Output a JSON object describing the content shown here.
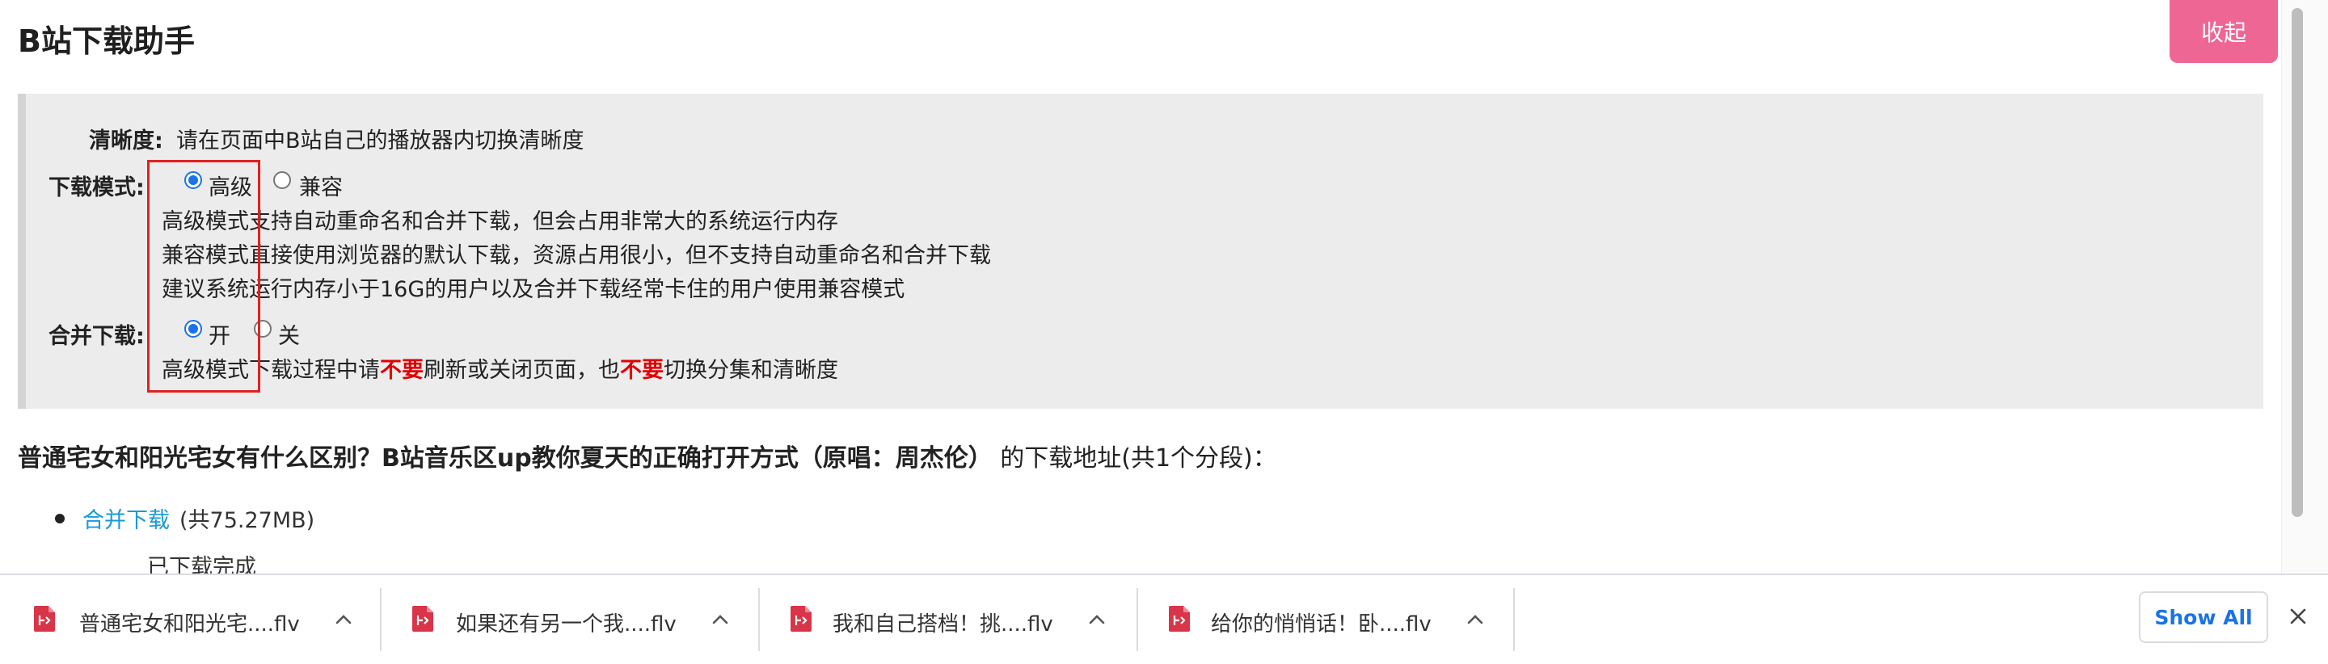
{
  "header": {
    "title": "B站下载助手",
    "collapse_label": "收起"
  },
  "settings": {
    "quality_label": "清晰度:",
    "quality_text": "请在页面中B站自己的播放器内切换清晰度",
    "mode_label": "下载模式:",
    "mode_options": [
      "高级",
      "兼容"
    ],
    "mode_selected": "高级",
    "mode_notes": [
      "高级模式支持自动重命名和合并下载，但会占用非常大的系统运行内存",
      "兼容模式直接使用浏览器的默认下载，资源占用很小，但不支持自动重命名和合并下载",
      "建议系统运行内存小于16G的用户以及合并下载经常卡住的用户使用兼容模式"
    ],
    "merge_label": "合并下载:",
    "merge_options": [
      "开",
      "关"
    ],
    "merge_selected": "开",
    "merge_note": {
      "part1": "高级模式下载过程中请",
      "emph1": "不要",
      "part2": "刷新或关闭页面，也",
      "emph2": "不要",
      "part3": "切换分集和清晰度"
    }
  },
  "result": {
    "video_title": "普通宅女和阳光宅女有什么区别？B站音乐区up教你夏天的正确打开方式（原唱：周杰伦）",
    "suffix": " 的下载地址(共1个分段)：",
    "link_label": "合并下载",
    "size_text": "(共75.27MB)",
    "status": "已下载完成"
  },
  "downloads_bar": {
    "items": [
      {
        "name": "普通宅女和阳光宅....flv"
      },
      {
        "name": "如果还有另一个我....flv"
      },
      {
        "name": "我和自己搭档！挑....flv"
      },
      {
        "name": "给你的悄悄话！卧....flv"
      }
    ],
    "show_all_label": "Show All"
  },
  "colors": {
    "accent": "#1a73e8",
    "collapse_bg": "#ee6694",
    "warning": "#e00000",
    "link": "#1a9ad6"
  },
  "icons": {
    "file": "flv-file-icon",
    "chevron": "chevron-up-icon",
    "close": "close-icon"
  }
}
